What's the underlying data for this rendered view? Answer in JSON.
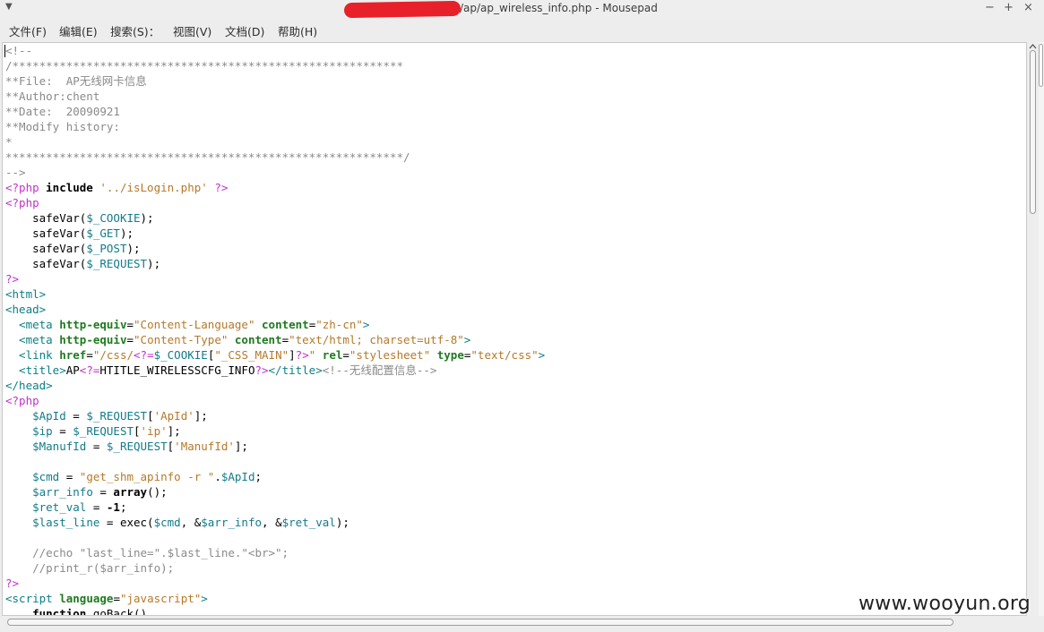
{
  "window": {
    "title": "/ap/ap_wireless_info.php - Mousepad",
    "controls": {
      "minimize": "−",
      "maximize": "+",
      "close": "×"
    }
  },
  "menubar": [
    {
      "label": "文件(F)"
    },
    {
      "label": "编辑(E)"
    },
    {
      "label": "搜索(S)："
    },
    {
      "label": "视图(V)"
    },
    {
      "label": "文档(D)"
    },
    {
      "label": "帮助(H)"
    }
  ],
  "editor": {
    "lines": [
      [
        [
          "c-com",
          "<!--"
        ]
      ],
      [
        [
          "c-com",
          "/**********************************************************"
        ]
      ],
      [
        [
          "c-com",
          "**File:  AP无线网卡信息"
        ]
      ],
      [
        [
          "c-com",
          "**Author:chent"
        ]
      ],
      [
        [
          "c-com",
          "**Date:  20090921"
        ]
      ],
      [
        [
          "c-com",
          "**Modify history:"
        ]
      ],
      [
        [
          "c-com",
          "*"
        ]
      ],
      [
        [
          "c-com",
          "***********************************************************/"
        ]
      ],
      [
        [
          "c-com",
          "-->"
        ]
      ],
      [
        [
          "c-php",
          "<?php "
        ],
        [
          "c-kw",
          "include"
        ],
        [
          "c-txt",
          " "
        ],
        [
          "c-str",
          "'../isLogin.php'"
        ],
        [
          "c-txt",
          " "
        ],
        [
          "c-php",
          "?>"
        ]
      ],
      [
        [
          "c-php",
          "<?php"
        ]
      ],
      [
        [
          "c-txt",
          "    safeVar("
        ],
        [
          "c-var",
          "$_COOKIE"
        ],
        [
          "c-txt",
          ");"
        ]
      ],
      [
        [
          "c-txt",
          "    safeVar("
        ],
        [
          "c-var",
          "$_GET"
        ],
        [
          "c-txt",
          ");"
        ]
      ],
      [
        [
          "c-txt",
          "    safeVar("
        ],
        [
          "c-var",
          "$_POST"
        ],
        [
          "c-txt",
          ");"
        ]
      ],
      [
        [
          "c-txt",
          "    safeVar("
        ],
        [
          "c-var",
          "$_REQUEST"
        ],
        [
          "c-txt",
          ");"
        ]
      ],
      [
        [
          "c-php",
          "?>"
        ]
      ],
      [
        [
          "c-tag",
          "<html>"
        ]
      ],
      [
        [
          "c-tag",
          "<head>"
        ]
      ],
      [
        [
          "c-tag",
          "  <meta "
        ],
        [
          "c-attr",
          "http-equiv"
        ],
        [
          "c-txt",
          "="
        ],
        [
          "c-str",
          "\"Content-Language\""
        ],
        [
          "c-txt",
          " "
        ],
        [
          "c-attr",
          "content"
        ],
        [
          "c-txt",
          "="
        ],
        [
          "c-str",
          "\"zh-cn\""
        ],
        [
          "c-tag",
          ">"
        ]
      ],
      [
        [
          "c-tag",
          "  <meta "
        ],
        [
          "c-attr",
          "http-equiv"
        ],
        [
          "c-txt",
          "="
        ],
        [
          "c-str",
          "\"Content-Type\""
        ],
        [
          "c-txt",
          " "
        ],
        [
          "c-attr",
          "content"
        ],
        [
          "c-txt",
          "="
        ],
        [
          "c-str",
          "\"text/html; charset=utf-8\""
        ],
        [
          "c-tag",
          ">"
        ]
      ],
      [
        [
          "c-tag",
          "  <link "
        ],
        [
          "c-attr",
          "href"
        ],
        [
          "c-txt",
          "="
        ],
        [
          "c-str",
          "\"/css/"
        ],
        [
          "c-php",
          "<?="
        ],
        [
          "c-var",
          "$_COOKIE"
        ],
        [
          "c-txt",
          "["
        ],
        [
          "c-str",
          "\"_CSS_MAIN\""
        ],
        [
          "c-txt",
          "]"
        ],
        [
          "c-php",
          "?>"
        ],
        [
          "c-str",
          "\""
        ],
        [
          "c-txt",
          " "
        ],
        [
          "c-attr",
          "rel"
        ],
        [
          "c-txt",
          "="
        ],
        [
          "c-str",
          "\"stylesheet\""
        ],
        [
          "c-txt",
          " "
        ],
        [
          "c-attr",
          "type"
        ],
        [
          "c-txt",
          "="
        ],
        [
          "c-str",
          "\"text/css\""
        ],
        [
          "c-tag",
          ">"
        ]
      ],
      [
        [
          "c-tag",
          "  <title>"
        ],
        [
          "c-txt",
          "AP"
        ],
        [
          "c-php",
          "<?="
        ],
        [
          "c-txt",
          "HTITLE_WIRELESSCFG_INFO"
        ],
        [
          "c-php",
          "?>"
        ],
        [
          "c-tag",
          "</title>"
        ],
        [
          "c-com",
          "<!--无线配置信息-->"
        ]
      ],
      [
        [
          "c-tag",
          "</head>"
        ]
      ],
      [
        [
          "c-php",
          "<?php"
        ]
      ],
      [
        [
          "c-txt",
          "    "
        ],
        [
          "c-var",
          "$ApId"
        ],
        [
          "c-txt",
          " = "
        ],
        [
          "c-var",
          "$_REQUEST"
        ],
        [
          "c-txt",
          "["
        ],
        [
          "c-str",
          "'ApId'"
        ],
        [
          "c-txt",
          "];"
        ]
      ],
      [
        [
          "c-txt",
          "    "
        ],
        [
          "c-var",
          "$ip"
        ],
        [
          "c-txt",
          " = "
        ],
        [
          "c-var",
          "$_REQUEST"
        ],
        [
          "c-txt",
          "["
        ],
        [
          "c-str",
          "'ip'"
        ],
        [
          "c-txt",
          "];"
        ]
      ],
      [
        [
          "c-txt",
          "    "
        ],
        [
          "c-var",
          "$ManufId"
        ],
        [
          "c-txt",
          " = "
        ],
        [
          "c-var",
          "$_REQUEST"
        ],
        [
          "c-txt",
          "["
        ],
        [
          "c-str",
          "'ManufId'"
        ],
        [
          "c-txt",
          "];"
        ]
      ],
      [
        [
          "c-txt",
          ""
        ]
      ],
      [
        [
          "c-txt",
          "    "
        ],
        [
          "c-var",
          "$cmd"
        ],
        [
          "c-txt",
          " = "
        ],
        [
          "c-str",
          "\"get_shm_apinfo -r \""
        ],
        [
          "c-txt",
          "."
        ],
        [
          "c-var",
          "$ApId"
        ],
        [
          "c-txt",
          ";"
        ]
      ],
      [
        [
          "c-txt",
          "    "
        ],
        [
          "c-var",
          "$arr_info"
        ],
        [
          "c-txt",
          " = "
        ],
        [
          "c-kw",
          "array"
        ],
        [
          "c-txt",
          "();"
        ]
      ],
      [
        [
          "c-txt",
          "    "
        ],
        [
          "c-var",
          "$ret_val"
        ],
        [
          "c-txt",
          " = "
        ],
        [
          "c-num",
          "-1"
        ],
        [
          "c-txt",
          ";"
        ]
      ],
      [
        [
          "c-txt",
          "    "
        ],
        [
          "c-var",
          "$last_line"
        ],
        [
          "c-txt",
          " = exec("
        ],
        [
          "c-var",
          "$cmd"
        ],
        [
          "c-txt",
          ", &"
        ],
        [
          "c-var",
          "$arr_info"
        ],
        [
          "c-txt",
          ", &"
        ],
        [
          "c-var",
          "$ret_val"
        ],
        [
          "c-txt",
          ");"
        ]
      ],
      [
        [
          "c-txt",
          ""
        ]
      ],
      [
        [
          "c-com",
          "    //echo \"last_line=\".$last_line.\"<br>\";"
        ]
      ],
      [
        [
          "c-com",
          "    //print_r($arr_info);"
        ]
      ],
      [
        [
          "c-php",
          "?>"
        ]
      ],
      [
        [
          "c-tag",
          "<script "
        ],
        [
          "c-attr",
          "language"
        ],
        [
          "c-txt",
          "="
        ],
        [
          "c-str",
          "\"javascript\""
        ],
        [
          "c-tag",
          ">"
        ]
      ],
      [
        [
          "c-txt",
          "    "
        ],
        [
          "c-kw",
          "function"
        ],
        [
          "c-txt",
          " goBack()"
        ]
      ]
    ]
  },
  "watermark": "www.wooyun.org"
}
